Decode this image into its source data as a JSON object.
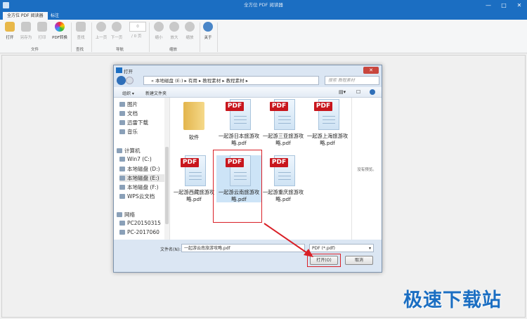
{
  "app": {
    "title": "全方位 PDF 阅读器",
    "tabs": [
      "全方位 PDF 阅读器",
      "标注"
    ],
    "brand_color": "#1b6ec2"
  },
  "ribbon": {
    "buttons": [
      {
        "label": "打开",
        "icon": "folder-open-icon",
        "enabled": true
      },
      {
        "label": "另存为",
        "icon": "save-icon",
        "enabled": false
      },
      {
        "label": "打印",
        "icon": "print-icon",
        "enabled": false
      },
      {
        "label": "PDF转换",
        "icon": "convert-icon",
        "enabled": true
      },
      {
        "label": "查找",
        "icon": "binoculars-icon",
        "enabled": false
      },
      {
        "label": "上一页",
        "icon": "arrow-up-icon",
        "enabled": false
      },
      {
        "label": "下一页",
        "icon": "arrow-down-icon",
        "enabled": false
      },
      {
        "label": "缩小",
        "icon": "zoom-out-icon",
        "enabled": false
      },
      {
        "label": "放大",
        "icon": "zoom-in-icon",
        "enabled": false
      },
      {
        "label": "缩放",
        "icon": "zoom-icon",
        "enabled": false
      },
      {
        "label": "关于",
        "icon": "info-icon",
        "enabled": true
      }
    ],
    "page_value": "0",
    "page_total": "/ 0 页",
    "groups": [
      "文件",
      "查找",
      "导航",
      "缩放"
    ]
  },
  "dialog": {
    "title": "打开",
    "breadcrumb": "« 本地磁盘 (E:) ▸ 有用 ▸ 教程素材 ▸ 教程素材 ▸",
    "search_placeholder": "搜索 教程素材",
    "toolbar": {
      "organize": "组织 ▾",
      "new_folder": "新建文件夹"
    },
    "nav": [
      "图片",
      "文档",
      "迅雷下载",
      "音乐",
      "计算机",
      "Win7 (C:)",
      "本地磁盘 (D:)",
      "本地磁盘 (E:)",
      "本地磁盘 (F:)",
      "WPS云文档",
      "网络",
      "PC20150315",
      "PC-2017060"
    ],
    "files": [
      {
        "name": "软件",
        "type": "folder"
      },
      {
        "name": "一起游日本旅游攻略.pdf",
        "type": "pdf"
      },
      {
        "name": "一起游三亚旅游攻略.pdf",
        "type": "pdf"
      },
      {
        "name": "一起游上海旅游攻略.pdf",
        "type": "pdf"
      },
      {
        "name": "一起游西藏旅游攻略.pdf",
        "type": "pdf"
      },
      {
        "name": "一起游云南旅游攻略.pdf",
        "type": "pdf",
        "selected": true
      },
      {
        "name": "一起游重庆旅游攻略.pdf",
        "type": "pdf"
      }
    ],
    "pdf_badge": "PDF",
    "preview_text": "没有预览。",
    "filename_label": "文件名(N):",
    "filename_value": "一起游云南旅游攻略.pdf",
    "filter_value": "PDF (*.pdf)",
    "open_label": "打开(O)",
    "cancel_label": "取消"
  },
  "watermark": "极速下载站"
}
